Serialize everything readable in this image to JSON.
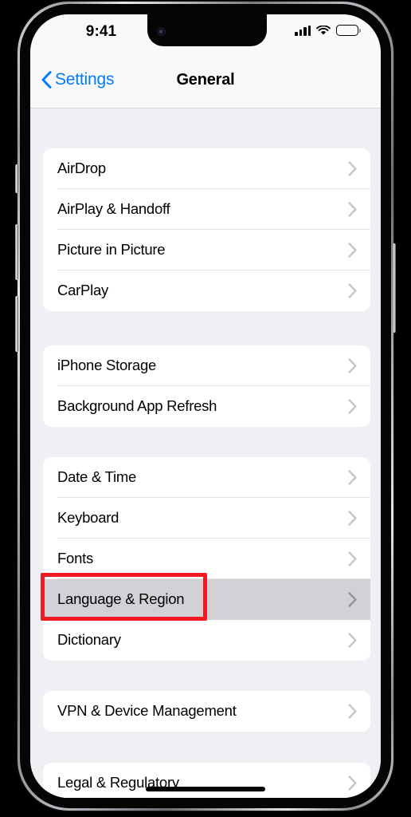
{
  "device": {
    "name": "iphone-14-pro",
    "frame_color": "#b4b4ba",
    "screen_bg": "#f0eff4"
  },
  "status_bar": {
    "time": "9:41",
    "cellular_icon": "signal-bars-icon",
    "cellular_bars": 4,
    "wifi_icon": "wifi-icon",
    "battery_icon": "battery-icon",
    "battery_level": 100
  },
  "nav_bar": {
    "back_icon": "chevron-left-icon",
    "back_label": "Settings",
    "title": "General",
    "accent_color": "#007aff",
    "background": "#f9f9f9"
  },
  "groups": [
    {
      "id": "connectivity",
      "rows": [
        {
          "label": "AirDrop",
          "accessory": "chevron-right-icon",
          "selected": false
        },
        {
          "label": "AirPlay & Handoff",
          "accessory": "chevron-right-icon",
          "selected": false
        },
        {
          "label": "Picture in Picture",
          "accessory": "chevron-right-icon",
          "selected": false
        },
        {
          "label": "CarPlay",
          "accessory": "chevron-right-icon",
          "selected": false
        }
      ]
    },
    {
      "id": "storage",
      "rows": [
        {
          "label": "iPhone Storage",
          "accessory": "chevron-right-icon",
          "selected": false
        },
        {
          "label": "Background App Refresh",
          "accessory": "chevron-right-icon",
          "selected": false
        }
      ]
    },
    {
      "id": "localization",
      "rows": [
        {
          "label": "Date & Time",
          "accessory": "chevron-right-icon",
          "selected": false
        },
        {
          "label": "Keyboard",
          "accessory": "chevron-right-icon",
          "selected": false
        },
        {
          "label": "Fonts",
          "accessory": "chevron-right-icon",
          "selected": false
        },
        {
          "label": "Language & Region",
          "accessory": "chevron-right-icon",
          "selected": true
        },
        {
          "label": "Dictionary",
          "accessory": "chevron-right-icon",
          "selected": false
        }
      ]
    },
    {
      "id": "management",
      "rows": [
        {
          "label": "VPN & Device Management",
          "accessory": "chevron-right-icon",
          "selected": false
        }
      ]
    },
    {
      "id": "legal",
      "rows": [
        {
          "label": "Legal & Regulatory",
          "accessory": "chevron-right-icon",
          "selected": false
        }
      ]
    }
  ],
  "annotation": {
    "target_label": "Language & Region",
    "color": "#ee1c22",
    "shape": "rectangle"
  },
  "selection": {
    "row_label": "Language & Region",
    "highlight_color": "#d1d1d6"
  },
  "home_indicator": "home-indicator-bar"
}
